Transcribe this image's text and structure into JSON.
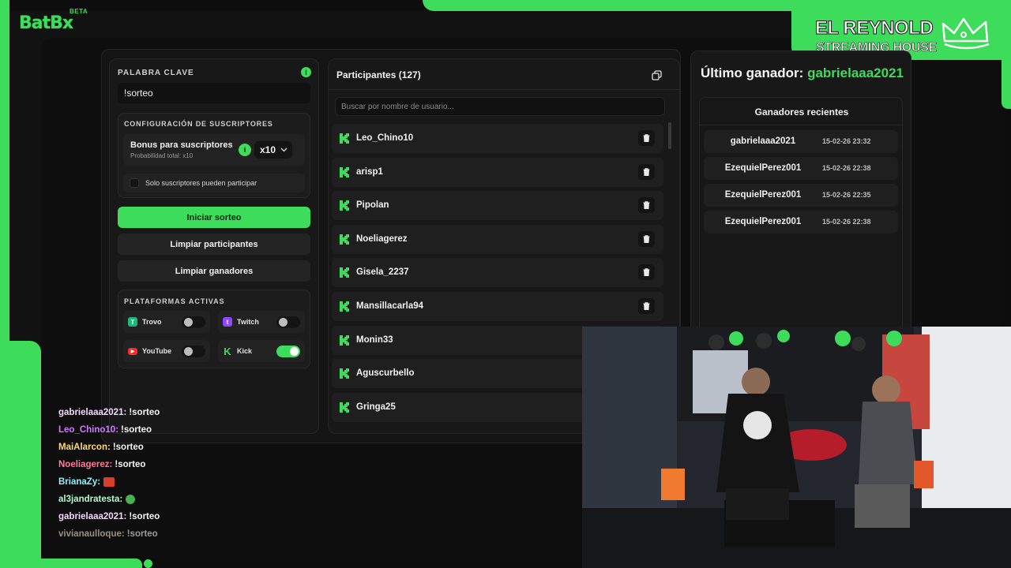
{
  "app": {
    "logo_text": "BatBx",
    "logo_badge": "BETA",
    "brand_line1": "EL REYNOLD",
    "brand_line2": "STREAMING HOUSE"
  },
  "colors": {
    "accent": "#3ddc5a",
    "panel": "#181818",
    "background": "#0d0d0d"
  },
  "keyword": {
    "label": "PALABRA CLAVE",
    "value": "!sorteo"
  },
  "subscribers": {
    "title": "CONFIGURACIÓN DE SUSCRIPTORES",
    "bonus_title": "Bonus para suscriptores",
    "bonus_subtitle": "Probabilidad total: x10",
    "multiplier": "x10",
    "only_subs_label": "Solo suscriptores pueden participar",
    "only_subs_checked": false
  },
  "actions": {
    "start": "Iniciar sorteo",
    "clear_participants": "Limpiar participantes",
    "clear_winners": "Limpiar ganadores"
  },
  "platforms": {
    "title": "PLATAFORMAS ACTIVAS",
    "items": [
      {
        "name": "Trovo",
        "icon": "trovo-icon",
        "enabled": false
      },
      {
        "name": "Twitch",
        "icon": "twitch-icon",
        "enabled": false
      },
      {
        "name": "YouTube",
        "icon": "youtube-icon",
        "enabled": false
      },
      {
        "name": "Kick",
        "icon": "kick-icon",
        "enabled": true
      }
    ]
  },
  "participants": {
    "title": "Participantes (127)",
    "search_placeholder": "Buscar por nombre de usuario...",
    "list": [
      "Leo_Chino10",
      "arisp1",
      "Pipolan",
      "Noeliagerez",
      "Gisela_2237",
      "Mansillacarla94",
      "Monin33",
      "Aguscurbello",
      "Gringa25"
    ]
  },
  "winners": {
    "last_label": "Último ganador:",
    "last_name": "gabrielaaa2021",
    "recent_title": "Ganadores recientes",
    "recent": [
      {
        "name": "gabrielaaa2021",
        "time": "15-02-26 23:32"
      },
      {
        "name": "EzequielPerez001",
        "time": "15-02-26 22:38"
      },
      {
        "name": "EzequielPerez001",
        "time": "15-02-26 22:35"
      },
      {
        "name": "EzequielPerez001",
        "time": "15-02-26 22:38"
      }
    ]
  },
  "chat": [
    {
      "user": "gabrielaaa2021:",
      "msg": "!sorteo",
      "color": "#f3d9ff"
    },
    {
      "user": "Leo_Chino10:",
      "msg": "!sorteo",
      "color": "#d07bff"
    },
    {
      "user": "MaiAlarcon:",
      "msg": "!sorteo",
      "color": "#ffd873"
    },
    {
      "user": "Noeliagerez:",
      "msg": "!sorteo",
      "color": "#ff7a9a"
    },
    {
      "user": "BrianaZy:",
      "msg": "",
      "color": "#8ff0ff",
      "emote": "red-emote"
    },
    {
      "user": "al3jandratesta:",
      "msg": "",
      "color": "#b5f7d0",
      "emote": "green-emote"
    },
    {
      "user": "gabrielaaa2021:",
      "msg": "!sorteo",
      "color": "#f3d9ff"
    },
    {
      "user": "vivianaulloque:",
      "msg": "!sorteo",
      "color": "#9a8f80"
    }
  ]
}
